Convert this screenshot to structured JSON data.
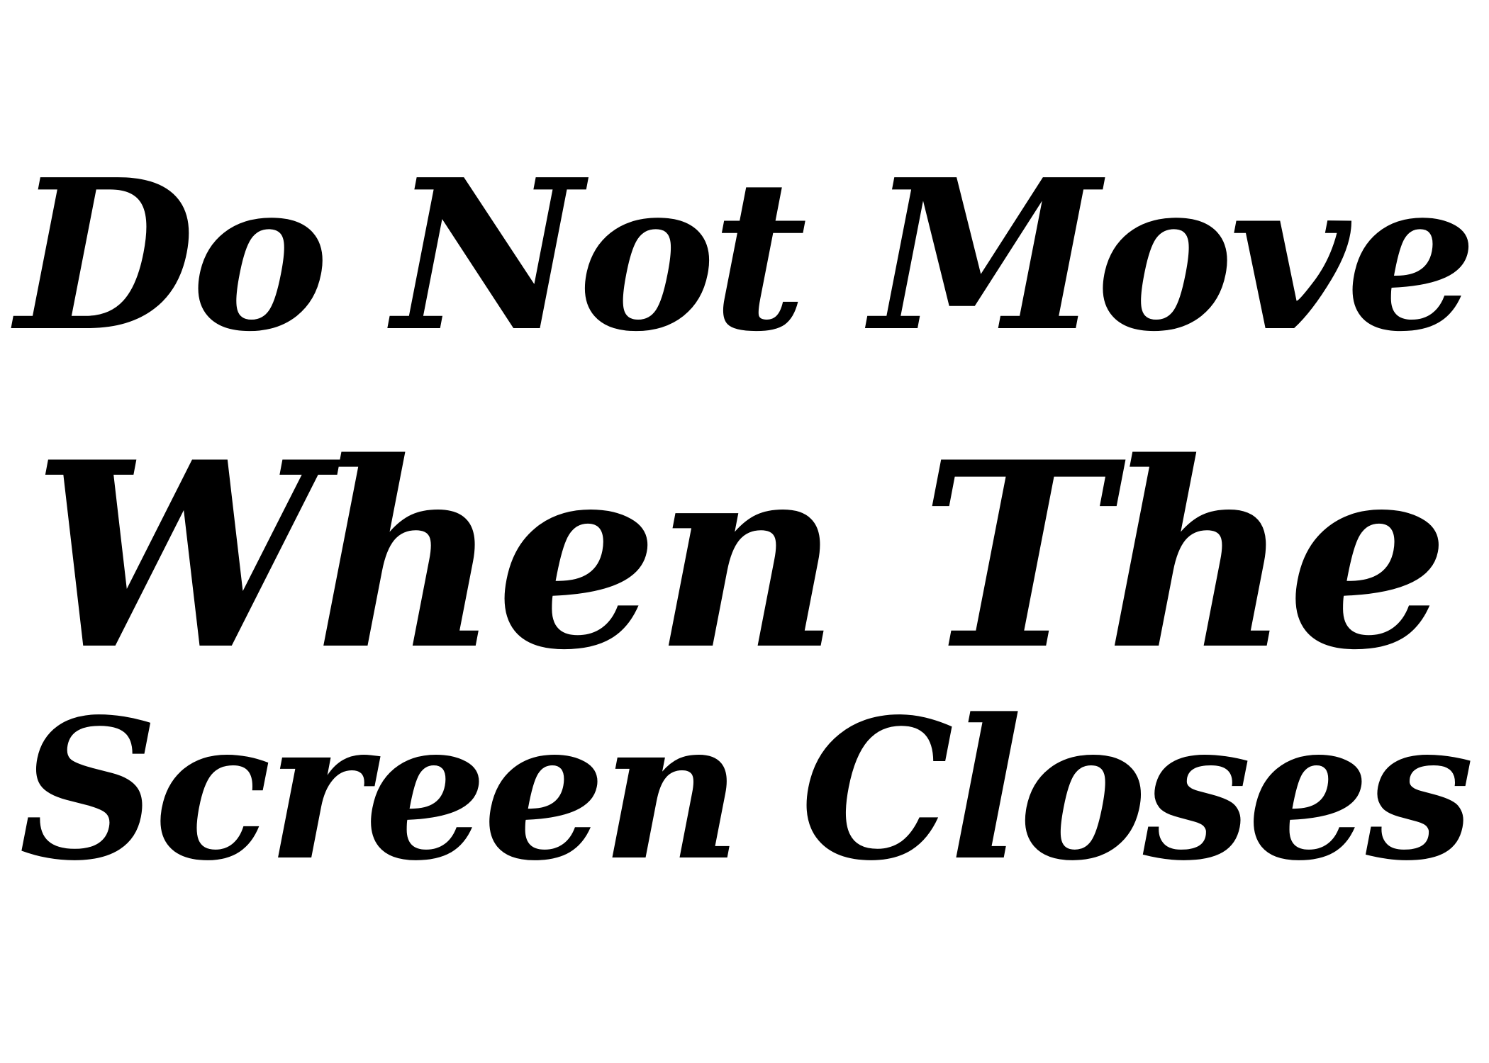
{
  "sign": {
    "line1": "Do Not Move",
    "line2": "When The",
    "line3": "Screen Closes"
  },
  "colors": {
    "text": "#000000",
    "background": "#ffffff"
  }
}
